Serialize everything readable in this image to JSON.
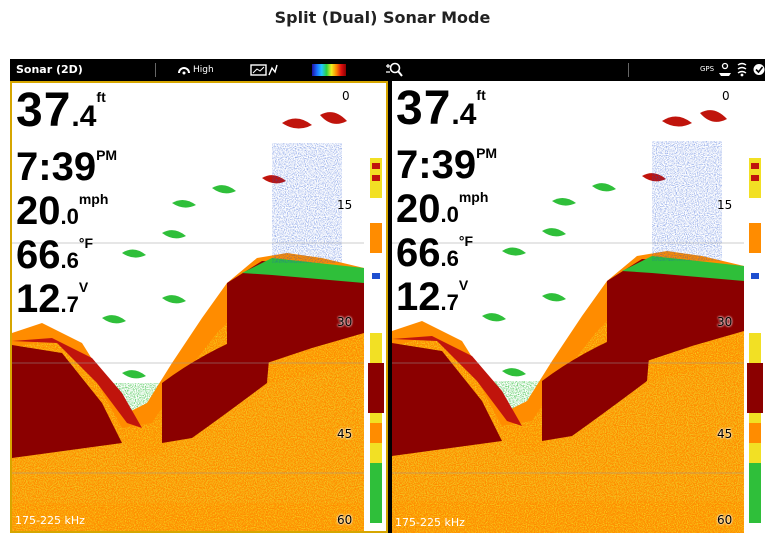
{
  "page": {
    "title": "Split (Dual) Sonar Mode"
  },
  "statusbar": {
    "title": "Sonar (2D)",
    "quality_label": "High",
    "gps_label": "GPS",
    "colors": {
      "background": "#000000",
      "text": "#ffffff"
    },
    "icons": [
      "quality-icon",
      "graph-icon",
      "color-palette",
      "zoom-icon",
      "gps-icon",
      "boat-icon",
      "sonar-icon",
      "settings-icon"
    ]
  },
  "panes": [
    {
      "id": "left",
      "selected": true,
      "depth": {
        "int": "37",
        "dec": ".4",
        "unit": "ft"
      },
      "time": {
        "value": "7:39",
        "unit": "PM"
      },
      "speed": {
        "int": "20",
        "dec": ".0",
        "unit": "mph"
      },
      "temp": {
        "int": "66",
        "dec": ".6",
        "unit": "°F"
      },
      "voltage": {
        "int": "12",
        "dec": ".7",
        "unit": "V"
      },
      "depth_scale": [
        "0",
        "15",
        "30",
        "45",
        "60"
      ],
      "frequency": "175-225 kHz"
    },
    {
      "id": "right",
      "selected": false,
      "depth": {
        "int": "37",
        "dec": ".4",
        "unit": "ft"
      },
      "time": {
        "value": "7:39",
        "unit": "PM"
      },
      "speed": {
        "int": "20",
        "dec": ".0",
        "unit": "mph"
      },
      "temp": {
        "int": "66",
        "dec": ".6",
        "unit": "°F"
      },
      "voltage": {
        "int": "12",
        "dec": ".7",
        "unit": "V"
      },
      "depth_scale": [
        "0",
        "15",
        "30",
        "45",
        "60"
      ],
      "frequency": "175-225 kHz"
    }
  ],
  "colors": {
    "selected_border": "#d6a600",
    "bottom_dark": "#8b0000",
    "bottom_red": "#c0140c",
    "echo_orange": "#ff8c00",
    "echo_yellow": "#f2e024",
    "echo_green": "#2fbf3a",
    "echo_blue": "#1e4fd0"
  }
}
